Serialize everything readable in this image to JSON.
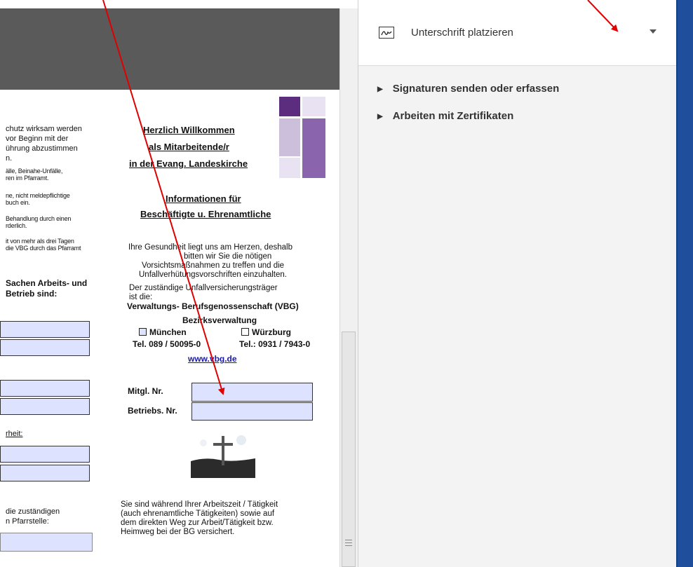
{
  "panel": {
    "sign_label": "Unterschrift platzieren",
    "accordion": [
      {
        "label": "Signaturen senden oder erfassen"
      },
      {
        "label": "Arbeiten mit Zertifikaten"
      }
    ]
  },
  "document": {
    "left_column": {
      "lines": [
        "chutz wirksam werden",
        " vor Beginn mit der",
        "ührung abzustimmen",
        "n."
      ],
      "small_lines": [
        "älle, Beinahe-Unfälle,",
        "ren im Pfarramt.",
        "ne, nicht meldepflichtige",
        "buch ein.",
        "Behandlung durch einen",
        "rderlich.",
        "it von mehr als drei Tagen",
        "die VBG durch das Pfarramt"
      ],
      "bold_lines": [
        " Sachen  Arbeits- und",
        "Betrieb sind:"
      ],
      "heit_label": "rheit:",
      "pfarr_lines": [
        "die zuständigen",
        "n Pfarrstelle:"
      ]
    },
    "right_column": {
      "welcome_lines": [
        "Herzlich Willkommen",
        "als Mitarbeitende/r",
        "in der Evang. Landeskirche"
      ],
      "info_lines": [
        "Informationen für",
        "Beschäftigte u. Ehrenamtliche"
      ],
      "health_lines": [
        "Ihre Gesundheit liegt uns am Herzen, deshalb",
        "bitten wir Sie die nötigen",
        "Vorsichtsmaßnahmen zu treffen und die",
        "Unfallverhütungsvorschriften einzuhalten."
      ],
      "carrier_lines": [
        "Der zuständige Unfallversicherungsträger",
        "ist die:"
      ],
      "vbg_name": "Verwaltungs- Berufsgenossenschaft (VBG)",
      "bezirk": "Bezirksverwaltung",
      "option_muenchen": "München",
      "option_wuerzburg": "Würzburg",
      "tel_muenchen": "Tel. 089 / 50095-0",
      "tel_wuerzburg": "Tel.: 0931 / 7943-0",
      "website": "www.vbg.de",
      "mitgl_label": "Mitgl. Nr.",
      "betriebs_label": "Betriebs. Nr.",
      "footer_lines": [
        "Sie sind während Ihrer Arbeitszeit / Tätigkeit",
        "(auch ehrenamtliche Tätigkeiten) sowie auf",
        "dem direkten Weg zur Arbeit/Tätigkeit bzw.",
        "Heimweg bei der BG versichert."
      ]
    }
  },
  "colors": {
    "annotation_arrow": "#e00000",
    "field_fill": "#dde3ff",
    "logo_purple_dark": "#5c2d7e",
    "logo_purple_mid": "#8a64ad",
    "logo_purple_light": "#cbbfdc",
    "taskbar_blue": "#1f4f9c"
  },
  "icons": [
    "signature-icon",
    "chevron-down-icon",
    "triangle-right-icon",
    "scroll-grip-icon"
  ]
}
